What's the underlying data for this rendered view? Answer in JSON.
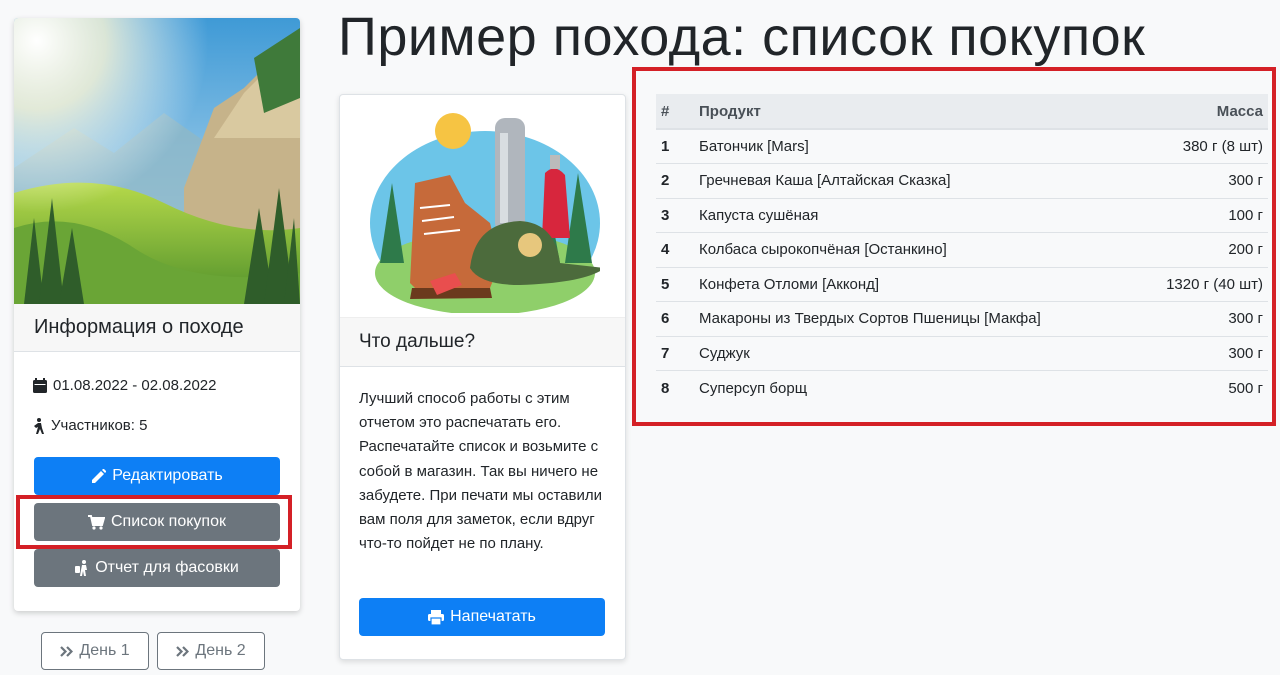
{
  "page": {
    "title": "Пример похода: список покупок"
  },
  "info_card": {
    "heading": "Информация о походе",
    "dates": "01.08.2022 - 02.08.2022",
    "participants": "Участников: 5",
    "buttons": {
      "edit": "Редактировать",
      "shopping_list": "Список покупок",
      "packing_report": "Отчет для фасовки"
    }
  },
  "day_nav": {
    "day1": "День 1",
    "day2": "День 2"
  },
  "next_card": {
    "heading": "Что дальше?",
    "text": "Лучший способ работы с этим отчетом это распечатать его. Распечатайте список и возьмите с собой в магазин. Так вы ничего не забудете. При печати мы оставили вам поля для заметок, если вдруг что-то пойдет не по плану.",
    "print_button": "Напечатать"
  },
  "table": {
    "headers": {
      "num": "#",
      "product": "Продукт",
      "mass": "Масса"
    },
    "rows": [
      {
        "num": "1",
        "product": "Батончик [Mars]",
        "mass": "380 г (8 шт)"
      },
      {
        "num": "2",
        "product": "Гречневая Каша [Алтайская Сказка]",
        "mass": "300 г"
      },
      {
        "num": "3",
        "product": "Капуста сушёная",
        "mass": "100 г"
      },
      {
        "num": "4",
        "product": "Колбаса сырокопчёная [Останкино]",
        "mass": "200 г"
      },
      {
        "num": "5",
        "product": "Конфета Отломи [Акконд]",
        "mass": "1320 г (40 шт)"
      },
      {
        "num": "6",
        "product": "Макароны из Твердых Сортов Пшеницы [Макфа]",
        "mass": "300 г"
      },
      {
        "num": "7",
        "product": "Суджук",
        "mass": "300 г"
      },
      {
        "num": "8",
        "product": "Суперсуп борщ",
        "mass": "500 г"
      }
    ]
  },
  "colors": {
    "primary": "#0d7ff5",
    "secondary": "#6c757d",
    "highlight": "#d42026"
  },
  "icons": {
    "dates": "calendar-icon",
    "participants": "hiker-icon",
    "edit": "pencil-icon",
    "shopping": "cart-icon",
    "packing": "person-luggage-icon",
    "day_nav": "double-chevron-right-icon",
    "print": "printer-icon"
  }
}
